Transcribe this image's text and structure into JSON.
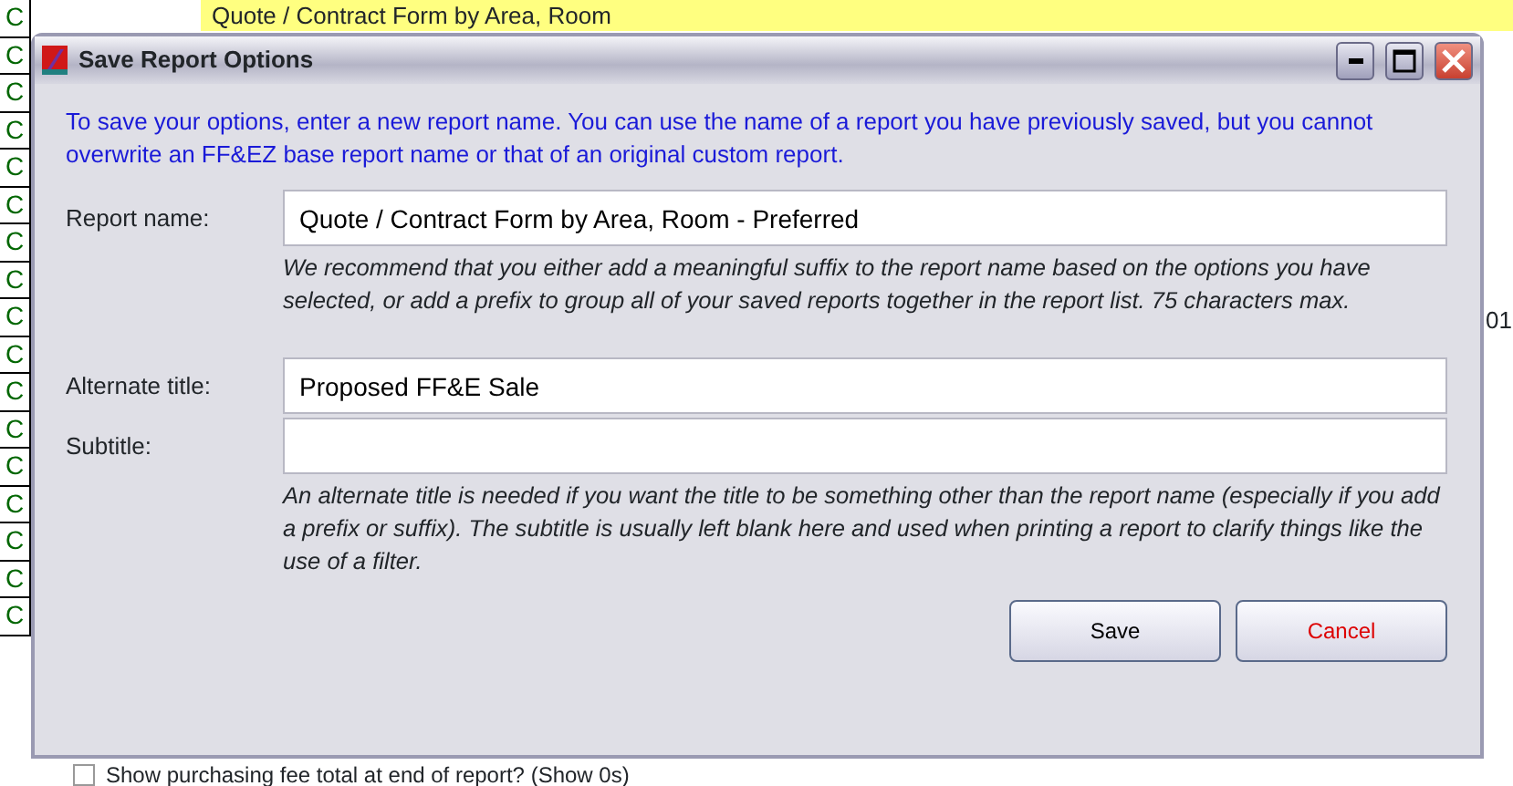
{
  "background": {
    "header_row": "Quote / Contract Form by Area, Room",
    "left_cells": [
      "C",
      "C",
      "C",
      "C",
      "C",
      "C",
      "C",
      "C",
      "C",
      "C",
      "C",
      "C",
      "C",
      "C",
      "C",
      "C",
      "C"
    ],
    "right_cell": "01",
    "option": {
      "label": "Show purchasing fee total at end of report?  (Show 0s)",
      "checked": false
    }
  },
  "window": {
    "title": "Save Report Options"
  },
  "intro": "To save your options, enter a new report name. You can use the name of a report you have previously saved, but you cannot overwrite an FF&EZ base report name or that of an original custom report.",
  "report_name": {
    "label": "Report name:",
    "value": "Quote / Contract Form by Area, Room - Preferred",
    "hint": "We recommend that you either add a meaningful suffix to the report name based on the options you have selected, or add a prefix to group all of your saved reports together in the report list. 75 characters max."
  },
  "alternate_title": {
    "label": "Alternate title:",
    "value": "Proposed FF&E Sale"
  },
  "subtitle": {
    "label": "Subtitle:"
  },
  "title_hint": "An alternate title is needed if you want the title to be something other than the report name (especially if you add a prefix or suffix). The subtitle is usually left blank here and used when printing a report to clarify things like the use of a filter.",
  "buttons": [
    {
      "label": "Save",
      "kind": "default"
    },
    {
      "label": "Cancel",
      "kind": "cancel"
    }
  ]
}
